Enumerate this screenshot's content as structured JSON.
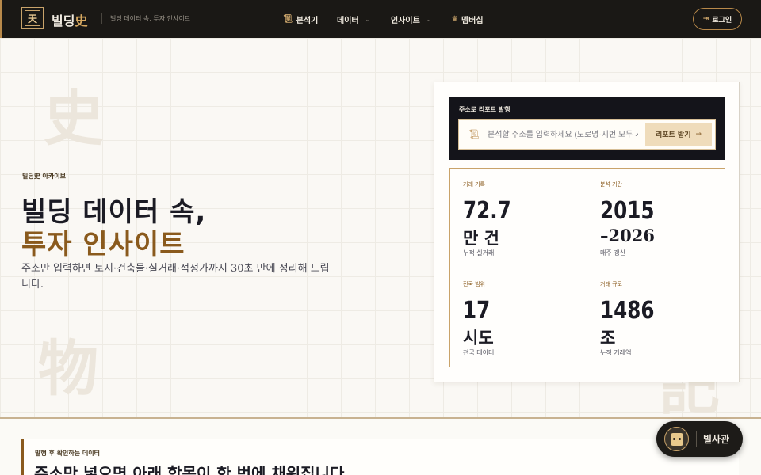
{
  "header": {
    "logo_glyph": "天",
    "brand_main": "빌딩",
    "brand_hanja": "史",
    "tagline": "빌딩 데이터 속, 투자 인사이트",
    "nav": [
      {
        "label": "분석기",
        "icon": "scroll-icon"
      },
      {
        "label": "데이터",
        "icon": "chevron-down-icon"
      },
      {
        "label": "인사이트",
        "icon": "chevron-down-icon"
      },
      {
        "label": "멤버십",
        "icon": "crown-icon"
      }
    ],
    "login_label": "로그인"
  },
  "watermarks": [
    "史",
    "物",
    "記"
  ],
  "hero": {
    "eyebrow": "빌딩史 아카이브",
    "title_line1": "빌딩 데이터 속,",
    "title_line2": "투자 인사이트",
    "description": "주소만 입력하면 토지·건축물·실거래·적정가까지 30초 만에 정리해 드립니다."
  },
  "report": {
    "label": "주소로 리포트 발행",
    "search_placeholder": "분석할 주소를 입력하세요 (도로명·지번 모두 가능)",
    "button_label": "리포트 받기",
    "button_arrow": "→"
  },
  "stats": [
    {
      "label": "거래 기록",
      "value": "72.7",
      "unit": "만 건",
      "note": "누적 실거래"
    },
    {
      "label": "분석 기간",
      "value": "2015",
      "unit": "–2026",
      "note": "매주 갱신"
    },
    {
      "label": "전국 범위",
      "value": "17",
      "unit": "시도",
      "note": "전국 데이터"
    },
    {
      "label": "거래 규모",
      "value": "1486",
      "unit": "조",
      "note": "누적 거래액"
    }
  ],
  "notice": {
    "label": "발행 후 확인하는 데이터",
    "title": "주소만 넣으면 아래 항목이 한 번에 채워집니다."
  },
  "assistant": {
    "label": "빌사관"
  },
  "colors": {
    "header_bg": "#1a1815",
    "accent_gold": "#b8894a",
    "title_brown": "#8a5a1d",
    "ink": "#1b1b24"
  }
}
